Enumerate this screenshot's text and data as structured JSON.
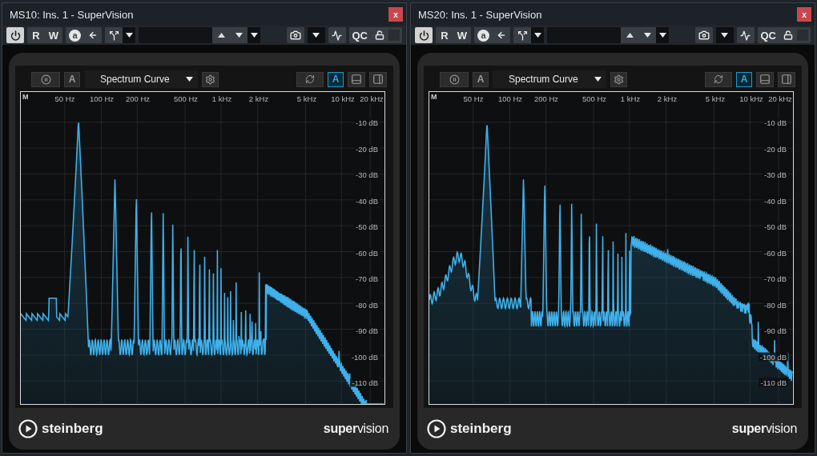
{
  "windows": [
    {
      "title": "MS10: Ins. 1 - SuperVision",
      "close": "x",
      "toolbar": {
        "power_on": true,
        "read": "R",
        "write": "W",
        "auto": "a",
        "qc": "QC"
      },
      "plugin": {
        "pause_on": false,
        "auto_left": {
          "label": "A",
          "selected": false
        },
        "mode": "Spectrum Curve",
        "auto_right": {
          "label": "A",
          "selected": true
        },
        "graph": {
          "channel": "M",
          "freq_labels": [
            "50 Hz",
            "100 Hz",
            "200 Hz",
            "500 Hz",
            "1 kHz",
            "2 kHz",
            "5 kHz",
            "10 kHz",
            "20 kHz"
          ],
          "db_labels": [
            "-10 dB",
            "-20 dB",
            "-30 dB",
            "-40 dB",
            "-50 dB",
            "-60 dB",
            "-70 dB",
            "-80 dB",
            "-90 dB",
            "-100 dB",
            "-110 dB"
          ]
        },
        "footer": {
          "brand": "steinberg",
          "product": "**super**vision"
        }
      }
    },
    {
      "title": "MS20: Ins. 1 - SuperVision",
      "close": "x",
      "toolbar": {
        "power_on": true,
        "read": "R",
        "write": "W",
        "auto": "a",
        "qc": "QC"
      },
      "plugin": {
        "pause_on": false,
        "auto_left": {
          "label": "A",
          "selected": false
        },
        "mode": "Spectrum Curve",
        "auto_right": {
          "label": "A",
          "selected": true
        },
        "graph": {
          "channel": "M",
          "freq_labels": [
            "50 Hz",
            "100 Hz",
            "200 Hz",
            "500 Hz",
            "1 kHz",
            "2 kHz",
            "5 kHz",
            "10 kHz",
            "20 kHz"
          ],
          "db_labels": [
            "-10 dB",
            "-20 dB",
            "-30 dB",
            "-40 dB",
            "-50 dB",
            "-60 dB",
            "-70 dB",
            "-80 dB",
            "-90 dB",
            "-100 dB",
            "-110 dB"
          ]
        },
        "footer": {
          "brand": "steinberg",
          "product": "**super**vision"
        }
      }
    }
  ]
}
